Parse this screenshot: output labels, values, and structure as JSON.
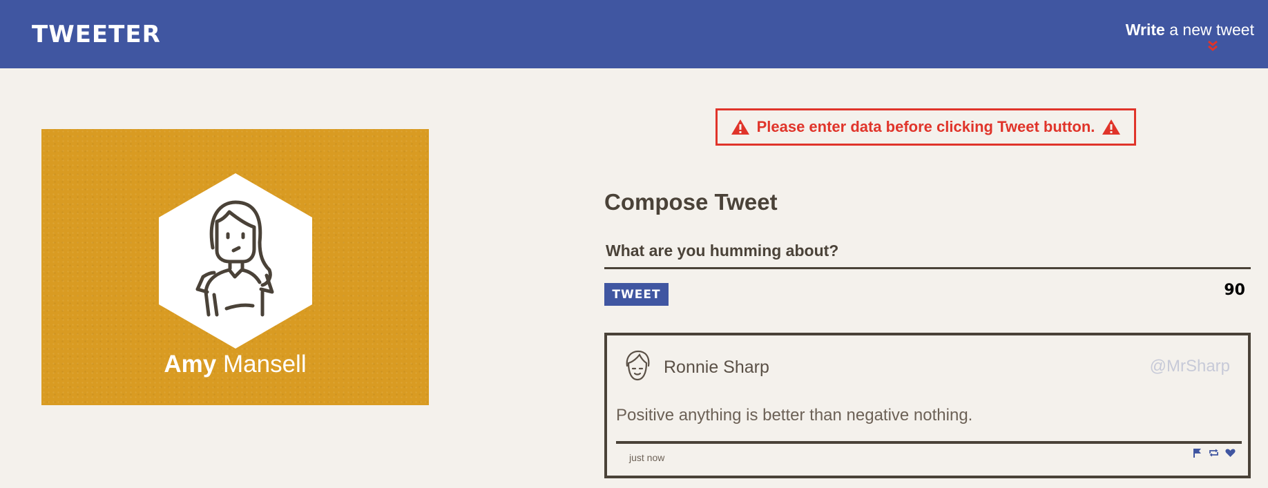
{
  "header": {
    "brand": "TWEETER",
    "write_bold": "Write",
    "write_rest": "a new tweet"
  },
  "profile": {
    "first_name": "Amy",
    "last_name": "Mansell",
    "background_color": "#d99b22"
  },
  "error": {
    "message": "Please enter data before clicking Tweet button."
  },
  "compose": {
    "title": "Compose Tweet",
    "placeholder": "What are you humming about?",
    "value": "",
    "button_label": "TWEET",
    "counter": "90"
  },
  "tweets": [
    {
      "name": "Ronnie Sharp",
      "handle": "@MrSharp",
      "text": "Positive anything is better than negative nothing.",
      "time": "just now"
    }
  ],
  "colors": {
    "nav": "#4056a1",
    "page_bg": "#f4f1ec",
    "error": "#e0342a",
    "text": "#4a4238"
  }
}
